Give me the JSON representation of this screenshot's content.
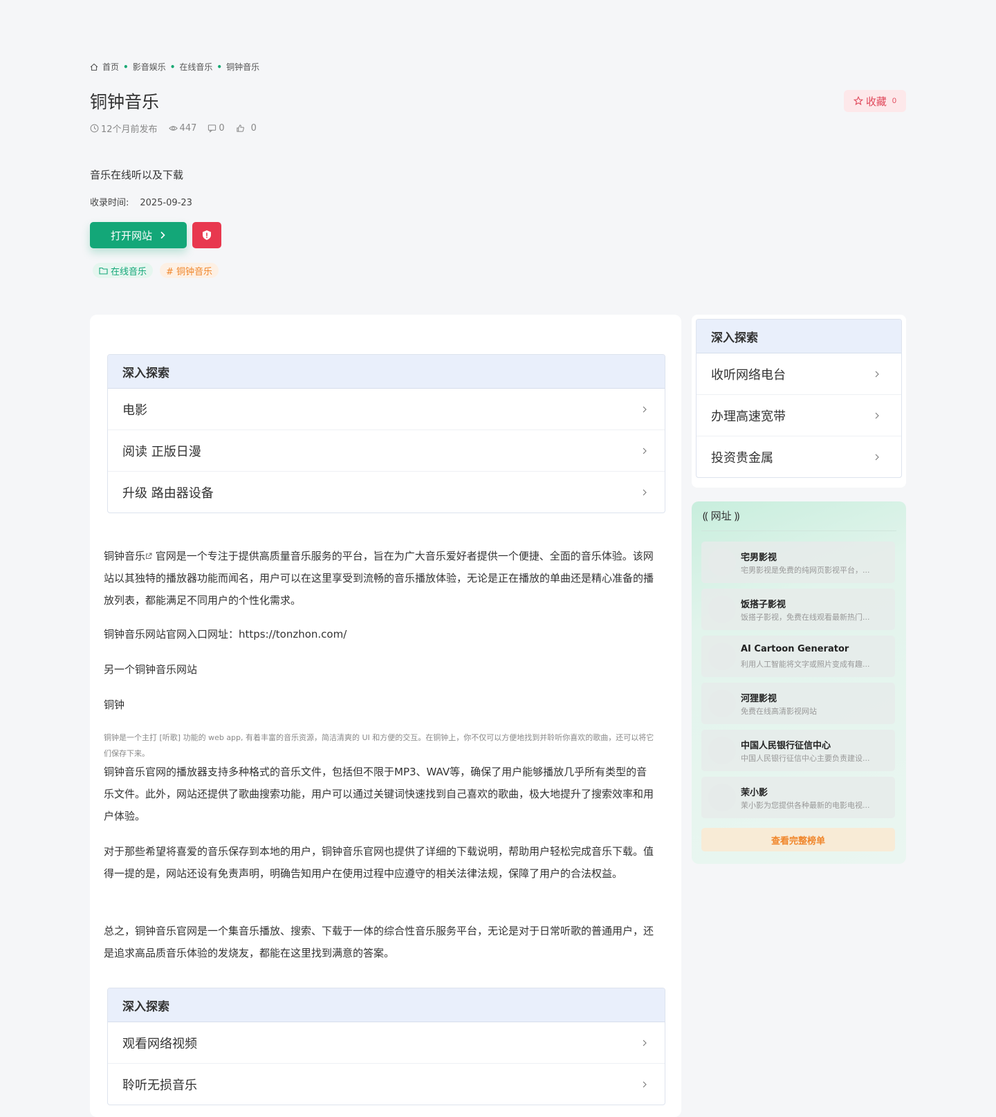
{
  "breadcrumb": [
    "首页",
    "影音娱乐",
    "在线音乐",
    "铜钟音乐"
  ],
  "title": "铜钟音乐",
  "favorite": {
    "label": "收藏",
    "count": "0"
  },
  "meta": {
    "published": "12个月前发布",
    "views": "447",
    "comments": "0",
    "likes": "0"
  },
  "description": "音乐在线听以及下载",
  "record": {
    "label": "收录时间:",
    "date": "2025-09-23"
  },
  "open_button": "打开网站",
  "tags": {
    "category": "在线音乐",
    "keyword": "# 铜钟音乐"
  },
  "explore_top": {
    "title": "深入探索",
    "items": [
      "电影",
      "阅读 正版日漫",
      "升级 路由器设备"
    ]
  },
  "article": {
    "p1_link": "铜钟音乐",
    "p1_rest": " 官网是一个专注于提供高质量音乐服务的平台，旨在为广大音乐爱好者提供一个便捷、全面的音乐体验。该网站以其独特的播放器功能而闻名，用户可以在这里享受到流畅的音乐播放体验，无论是正在播放的单曲还是精心准备的播放列表，都能满足不同用户的个性化需求。",
    "p2": "铜钟音乐网站官网入口网址：https://tonzhon.com/",
    "p3": "另一个铜钟音乐网站",
    "p4": "铜钟",
    "note": "铜钟是一个主打 [听歌] 功能的 web app, 有着丰富的音乐资源，简洁清爽的 UI 和方便的交互。在铜钟上，你不仅可以方便地找到并聆听你喜欢的歌曲，还可以将它们保存下来。",
    "p5": "铜钟音乐官网的播放器支持多种格式的音乐文件，包括但不限于MP3、WAV等，确保了用户能够播放几乎所有类型的音乐文件。此外，网站还提供了歌曲搜索功能，用户可以通过关键词快速找到自己喜欢的歌曲，极大地提升了搜索效率和用户体验。",
    "p6": "对于那些希望将喜爱的音乐保存到本地的用户，铜钟音乐官网也提供了详细的下载说明，帮助用户轻松完成音乐下载。值得一提的是，网站还设有免责声明，明确告知用户在使用过程中应遵守的相关法律法规，保障了用户的合法权益。",
    "p7": "总之，铜钟音乐官网是一个集音乐播放、搜索、下载于一体的综合性音乐服务平台，无论是对于日常听歌的普通用户，还是追求高品质音乐体验的发烧友，都能在这里找到满意的答案。"
  },
  "explore_bottom": {
    "title": "深入探索",
    "items": [
      "观看网络视频",
      "聆听无损音乐"
    ]
  },
  "sidebar_explore": {
    "title": "深入探索",
    "items": [
      "收听网络电台",
      "办理高速宽带",
      "投资贵金属"
    ]
  },
  "sidebar_sites": {
    "title": "网址",
    "items": [
      {
        "name": "宅男影视",
        "desc": "宅男影视是免费的纯网页影视平台，..."
      },
      {
        "name": "饭搭子影视",
        "desc": "饭搭子影视，免费在线观看最新热门..."
      },
      {
        "name": "AI Cartoon Generator",
        "desc": "利用人工智能将文字或照片变成有趣..."
      },
      {
        "name": "河狸影视",
        "desc": "免费在线高清影视网站"
      },
      {
        "name": "中国人民银行征信中心",
        "desc": "中国人民银行征信中心主要负责建设..."
      },
      {
        "name": "茉小影",
        "desc": "茉小影为您提供各种最新的电影电视..."
      }
    ],
    "more": "查看完整榜单"
  }
}
